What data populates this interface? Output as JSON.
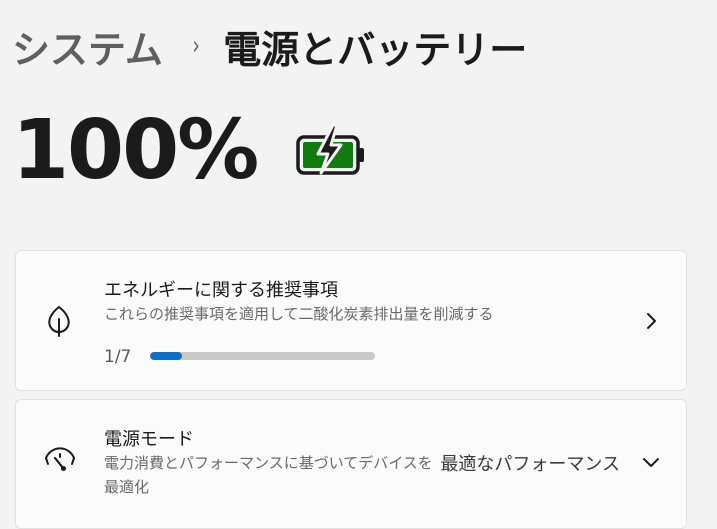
{
  "breadcrumb": {
    "parent": "システム",
    "separator": "›",
    "current": "電源とバッテリー"
  },
  "battery": {
    "percent_text": "100%",
    "icon": "battery-charging-icon",
    "fill_color": "#107c10",
    "level": 1.0
  },
  "recommendations": {
    "icon": "leaf-icon",
    "title": "エネルギーに関する推奨事項",
    "description": "これらの推奨事項を適用して二酸化炭素排出量を削減する",
    "progress_label": "1/7",
    "progress_fraction": 0.142857,
    "progress_color": "#0f6fc6",
    "chevron": "chevron-right-icon"
  },
  "power_mode": {
    "icon": "gauge-icon",
    "title": "電源モード",
    "description": "電力消費とパフォーマンスに基づいてデバイスを最適化",
    "value": "最適なパフォーマンス",
    "chevron": "chevron-down-icon"
  }
}
